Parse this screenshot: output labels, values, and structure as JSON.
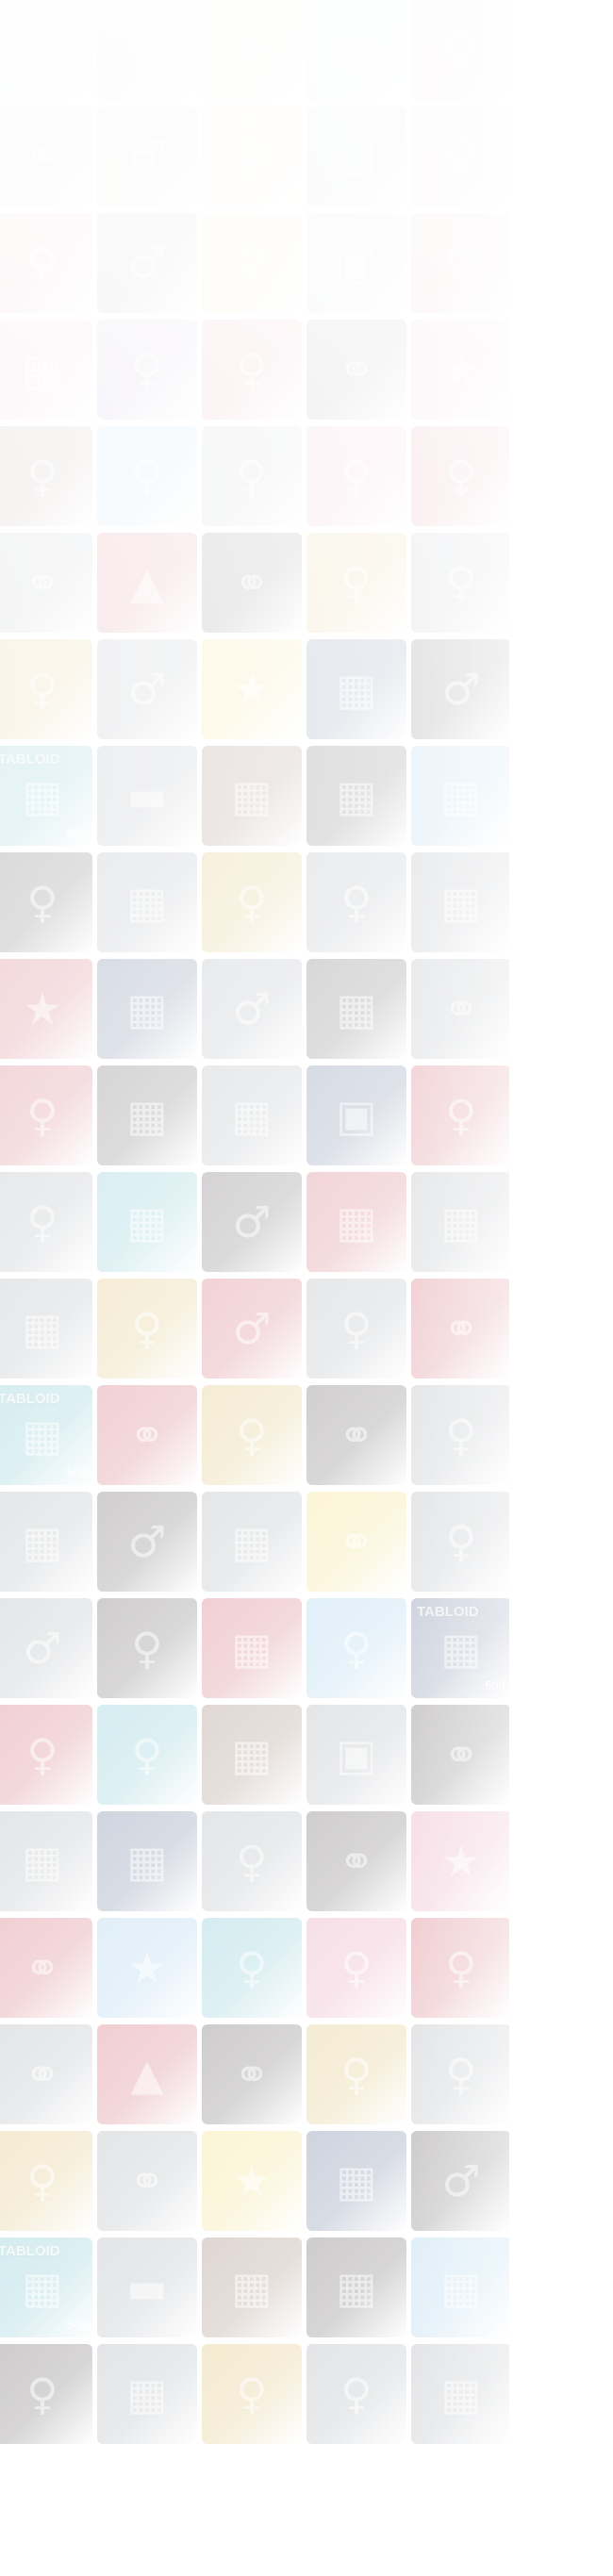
{
  "background": {
    "page_color": "#ffffff",
    "tile_palette": {
      "pink": "#e08aa6",
      "red": "#c94b5a",
      "teal": "#63b9c8",
      "purple": "#8b6aa8",
      "gold": "#d8b65a",
      "yellow": "#f1d86a",
      "gray": "#9aa0a8",
      "navy": "#4b5e86",
      "green": "#8fbf7a",
      "dark": "#4a4248",
      "brown": "#8a6a5a",
      "sky": "#8fc3e6"
    },
    "tiles": [
      {
        "color": "gray",
        "icon": "building-icon",
        "caption": "",
        "sub": ""
      },
      {
        "color": "pink",
        "icon": "woman-icon",
        "caption": "",
        "sub": ""
      },
      {
        "color": "gold",
        "icon": "star-icon",
        "caption": "",
        "sub": ""
      },
      {
        "color": "teal",
        "icon": "building-icon",
        "caption": "",
        "sub": ""
      },
      {
        "color": "red",
        "icon": "woman-icon",
        "caption": "",
        "sub": ""
      },
      {
        "color": "purple",
        "icon": "couple-icon",
        "caption": "",
        "sub": ""
      },
      {
        "color": "brown",
        "icon": "man-icon",
        "caption": "",
        "sub": ""
      },
      {
        "color": "yellow",
        "icon": "woman-icon",
        "caption": "",
        "sub": ""
      },
      {
        "color": "navy",
        "icon": "building-icon",
        "caption": "",
        "sub": ""
      },
      {
        "color": "pink",
        "icon": "woman-icon",
        "caption": "",
        "sub": ""
      },
      {
        "color": "red",
        "icon": "woman-icon",
        "caption": "",
        "sub": ""
      },
      {
        "color": "dark",
        "icon": "man-icon",
        "caption": "",
        "sub": ""
      },
      {
        "color": "gold",
        "icon": "woman-icon",
        "caption": "",
        "sub": ""
      },
      {
        "color": "gray",
        "icon": "frame-icon",
        "caption": "",
        "sub": ""
      },
      {
        "color": "red",
        "icon": "woman-icon",
        "caption": "",
        "sub": ""
      },
      {
        "color": "pink",
        "icon": "building-icon",
        "caption": "",
        "sub": ""
      },
      {
        "color": "purple",
        "icon": "woman-icon",
        "caption": "",
        "sub": ""
      },
      {
        "color": "red",
        "icon": "woman-icon",
        "caption": "",
        "sub": ""
      },
      {
        "color": "dark",
        "icon": "couple-icon",
        "caption": "",
        "sub": ""
      },
      {
        "color": "pink",
        "icon": "star-icon",
        "caption": "",
        "sub": ""
      },
      {
        "color": "brown",
        "icon": "woman-icon",
        "caption": "",
        "sub": ""
      },
      {
        "color": "sky",
        "icon": "woman-icon",
        "caption": "",
        "sub": ""
      },
      {
        "color": "gray",
        "icon": "woman-icon",
        "caption": "",
        "sub": ""
      },
      {
        "color": "pink",
        "icon": "woman-icon",
        "caption": "",
        "sub": ""
      },
      {
        "color": "red",
        "icon": "woman-icon",
        "caption": "",
        "sub": ""
      },
      {
        "color": "gray",
        "icon": "couple-icon",
        "caption": "",
        "sub": ""
      },
      {
        "color": "red",
        "icon": "tree-icon",
        "caption": "",
        "sub": ""
      },
      {
        "color": "dark",
        "icon": "couple-icon",
        "caption": "",
        "sub": ""
      },
      {
        "color": "gold",
        "icon": "woman-icon",
        "caption": "",
        "sub": ""
      },
      {
        "color": "gray",
        "icon": "woman-icon",
        "caption": "",
        "sub": ""
      },
      {
        "color": "gold",
        "icon": "woman-icon",
        "caption": "",
        "sub": ""
      },
      {
        "color": "gray",
        "icon": "man-icon",
        "caption": "",
        "sub": ""
      },
      {
        "color": "yellow",
        "icon": "star-icon",
        "caption": "",
        "sub": ""
      },
      {
        "color": "navy",
        "icon": "building-icon",
        "caption": "",
        "sub": ""
      },
      {
        "color": "dark",
        "icon": "man-icon",
        "caption": "",
        "sub": ""
      },
      {
        "color": "teal",
        "icon": "building-icon",
        "caption": "TABLOID",
        "sub": "500"
      },
      {
        "color": "gray",
        "icon": "car-icon",
        "caption": "",
        "sub": ""
      },
      {
        "color": "brown",
        "icon": "building-icon",
        "caption": "",
        "sub": ""
      },
      {
        "color": "dark",
        "icon": "building-icon",
        "caption": "",
        "sub": ""
      },
      {
        "color": "sky",
        "icon": "building-icon",
        "caption": "",
        "sub": ""
      },
      {
        "color": "dark",
        "icon": "woman-icon",
        "caption": "",
        "sub": ""
      },
      {
        "color": "gray",
        "icon": "building-icon",
        "caption": "",
        "sub": ""
      },
      {
        "color": "gold",
        "icon": "woman-icon",
        "caption": "",
        "sub": ""
      },
      {
        "color": "gray",
        "icon": "woman-icon",
        "caption": "",
        "sub": ""
      },
      {
        "color": "gray",
        "icon": "building-icon",
        "caption": "",
        "sub": ""
      },
      {
        "color": "red",
        "icon": "star-icon",
        "caption": "",
        "sub": ""
      },
      {
        "color": "navy",
        "icon": "building-icon",
        "caption": "",
        "sub": ""
      },
      {
        "color": "gray",
        "icon": "man-icon",
        "caption": "",
        "sub": ""
      },
      {
        "color": "dark",
        "icon": "building-icon",
        "caption": "",
        "sub": ""
      },
      {
        "color": "gray",
        "icon": "couple-icon",
        "caption": "",
        "sub": ""
      },
      {
        "color": "red",
        "icon": "woman-icon",
        "caption": "",
        "sub": ""
      },
      {
        "color": "dark",
        "icon": "building-icon",
        "caption": "",
        "sub": ""
      },
      {
        "color": "gray",
        "icon": "building-icon",
        "caption": "",
        "sub": ""
      },
      {
        "color": "navy",
        "icon": "frame-icon",
        "caption": "",
        "sub": ""
      },
      {
        "color": "red",
        "icon": "woman-icon",
        "caption": "",
        "sub": ""
      },
      {
        "color": "gray",
        "icon": "woman-icon",
        "caption": "",
        "sub": ""
      },
      {
        "color": "teal",
        "icon": "building-icon",
        "caption": "",
        "sub": ""
      },
      {
        "color": "dark",
        "icon": "man-icon",
        "caption": "",
        "sub": ""
      },
      {
        "color": "red",
        "icon": "building-icon",
        "caption": "",
        "sub": ""
      },
      {
        "color": "gray",
        "icon": "building-icon",
        "caption": "",
        "sub": ""
      },
      {
        "color": "gray",
        "icon": "building-icon",
        "caption": "",
        "sub": ""
      },
      {
        "color": "gold",
        "icon": "woman-icon",
        "caption": "",
        "sub": ""
      },
      {
        "color": "red",
        "icon": "man-icon",
        "caption": "",
        "sub": ""
      },
      {
        "color": "gray",
        "icon": "woman-icon",
        "caption": "",
        "sub": ""
      },
      {
        "color": "red",
        "icon": "couple-icon",
        "caption": "",
        "sub": ""
      },
      {
        "color": "teal",
        "icon": "building-icon",
        "caption": "TABLOID",
        "sub": "500"
      },
      {
        "color": "red",
        "icon": "couple-icon",
        "caption": "",
        "sub": ""
      },
      {
        "color": "gold",
        "icon": "woman-icon",
        "caption": "",
        "sub": ""
      },
      {
        "color": "dark",
        "icon": "couple-icon",
        "caption": "",
        "sub": ""
      },
      {
        "color": "gray",
        "icon": "woman-icon",
        "caption": "",
        "sub": ""
      },
      {
        "color": "gray",
        "icon": "building-icon",
        "caption": "",
        "sub": ""
      },
      {
        "color": "dark",
        "icon": "man-icon",
        "caption": "",
        "sub": ""
      },
      {
        "color": "gray",
        "icon": "building-icon",
        "caption": "",
        "sub": ""
      },
      {
        "color": "yellow",
        "icon": "couple-icon",
        "caption": "",
        "sub": ""
      },
      {
        "color": "gray",
        "icon": "woman-icon",
        "caption": "",
        "sub": ""
      },
      {
        "color": "gray",
        "icon": "man-icon",
        "caption": "",
        "sub": ""
      },
      {
        "color": "dark",
        "icon": "woman-icon",
        "caption": "",
        "sub": ""
      },
      {
        "color": "red",
        "icon": "building-icon",
        "caption": "",
        "sub": ""
      },
      {
        "color": "sky",
        "icon": "woman-icon",
        "caption": "",
        "sub": ""
      },
      {
        "color": "navy",
        "icon": "building-icon",
        "caption": "TABLOID",
        "sub": "500"
      },
      {
        "color": "red",
        "icon": "woman-icon",
        "caption": "",
        "sub": ""
      },
      {
        "color": "teal",
        "icon": "woman-icon",
        "caption": "",
        "sub": ""
      },
      {
        "color": "brown",
        "icon": "building-icon",
        "caption": "",
        "sub": ""
      },
      {
        "color": "gray",
        "icon": "frame-icon",
        "caption": "",
        "sub": ""
      },
      {
        "color": "dark",
        "icon": "couple-icon",
        "caption": "",
        "sub": ""
      },
      {
        "color": "gray",
        "icon": "building-icon",
        "caption": "",
        "sub": ""
      },
      {
        "color": "navy",
        "icon": "building-icon",
        "caption": "",
        "sub": ""
      },
      {
        "color": "gray",
        "icon": "woman-icon",
        "caption": "",
        "sub": ""
      },
      {
        "color": "dark",
        "icon": "couple-icon",
        "caption": "",
        "sub": ""
      },
      {
        "color": "pink",
        "icon": "star-icon",
        "caption": "",
        "sub": ""
      },
      {
        "color": "red",
        "icon": "couple-icon",
        "caption": "",
        "sub": ""
      },
      {
        "color": "sky",
        "icon": "star-icon",
        "caption": "",
        "sub": ""
      },
      {
        "color": "teal",
        "icon": "woman-icon",
        "caption": "",
        "sub": ""
      },
      {
        "color": "pink",
        "icon": "woman-icon",
        "caption": "",
        "sub": ""
      },
      {
        "color": "red",
        "icon": "woman-icon",
        "caption": "",
        "sub": ""
      },
      {
        "color": "gray",
        "icon": "couple-icon",
        "caption": "",
        "sub": ""
      },
      {
        "color": "red",
        "icon": "tree-icon",
        "caption": "",
        "sub": ""
      },
      {
        "color": "dark",
        "icon": "couple-icon",
        "caption": "",
        "sub": ""
      },
      {
        "color": "gold",
        "icon": "woman-icon",
        "caption": "",
        "sub": ""
      },
      {
        "color": "gray",
        "icon": "woman-icon",
        "caption": "",
        "sub": ""
      },
      {
        "color": "gold",
        "icon": "woman-icon",
        "caption": "",
        "sub": ""
      },
      {
        "color": "gray",
        "icon": "couple-icon",
        "caption": "",
        "sub": ""
      },
      {
        "color": "yellow",
        "icon": "star-icon",
        "caption": "",
        "sub": ""
      },
      {
        "color": "navy",
        "icon": "building-icon",
        "caption": "",
        "sub": ""
      },
      {
        "color": "dark",
        "icon": "man-icon",
        "caption": "",
        "sub": ""
      },
      {
        "color": "teal",
        "icon": "building-icon",
        "caption": "TABLOID",
        "sub": "500"
      },
      {
        "color": "gray",
        "icon": "car-icon",
        "caption": "",
        "sub": ""
      },
      {
        "color": "brown",
        "icon": "building-icon",
        "caption": "",
        "sub": ""
      },
      {
        "color": "dark",
        "icon": "building-icon",
        "caption": "",
        "sub": ""
      },
      {
        "color": "sky",
        "icon": "building-icon",
        "caption": "",
        "sub": ""
      },
      {
        "color": "dark",
        "icon": "woman-icon",
        "caption": "",
        "sub": ""
      },
      {
        "color": "gray",
        "icon": "building-icon",
        "caption": "",
        "sub": ""
      },
      {
        "color": "gold",
        "icon": "woman-icon",
        "caption": "",
        "sub": ""
      },
      {
        "color": "gray",
        "icon": "woman-icon",
        "caption": "",
        "sub": ""
      },
      {
        "color": "gray",
        "icon": "building-icon",
        "caption": "",
        "sub": ""
      }
    ]
  }
}
